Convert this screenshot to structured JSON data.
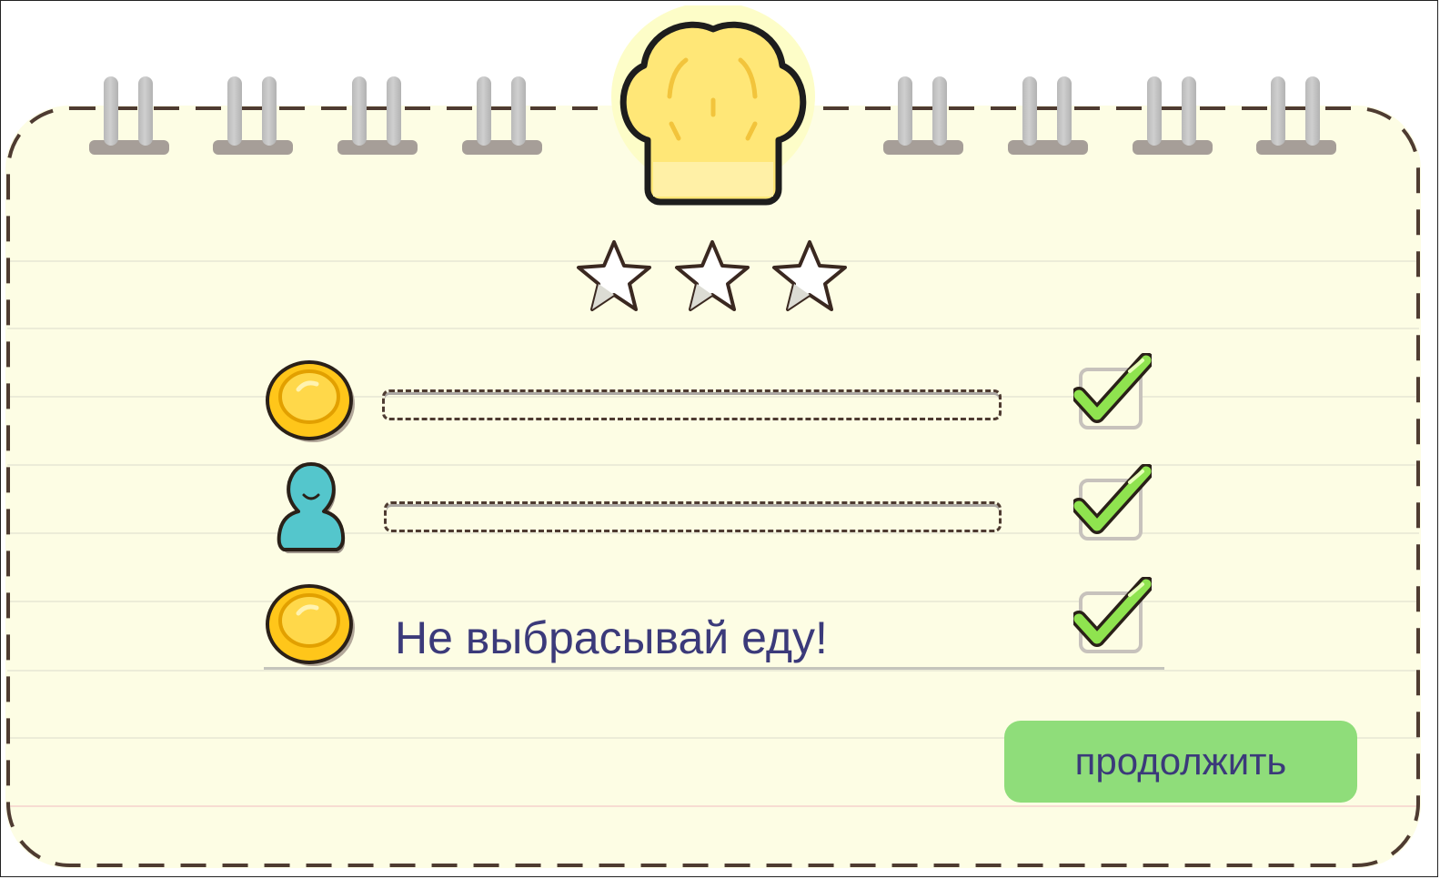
{
  "results_card": {
    "icon": "chef-hat-icon",
    "stars": {
      "earned": 0,
      "total": 3
    },
    "goals": [
      {
        "icon": "coin-icon",
        "text": "",
        "completed": true
      },
      {
        "icon": "person-icon",
        "text": "",
        "completed": true
      },
      {
        "icon": "coin-icon",
        "text": "Не выбрасывай еду!",
        "completed": true
      }
    ],
    "continue_label": "продолжить"
  },
  "colors": {
    "paper": "#fdfde4",
    "accent_green": "#8fdd7a",
    "text": "#3b3a7a",
    "coin": "#ffc61a",
    "person": "#54c6cc",
    "hat": "#ffe777"
  }
}
